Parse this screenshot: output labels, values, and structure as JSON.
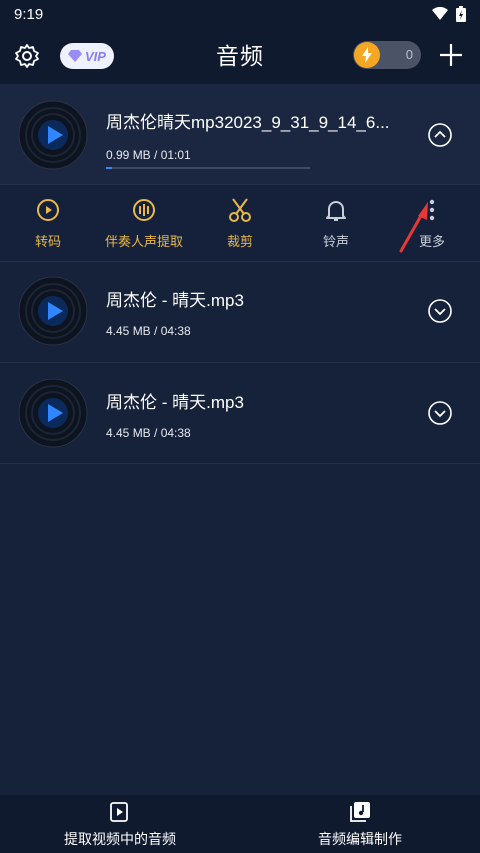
{
  "status": {
    "time": "9:19"
  },
  "header": {
    "title": "音频",
    "vip_label": "VIP",
    "coin_count": "0"
  },
  "files": [
    {
      "name": "周杰伦晴天mp32023_9_31_9_14_6...",
      "meta": "0.99 MB / 01:01",
      "progress": 0.03,
      "expanded": true
    },
    {
      "name": "周杰伦 - 晴天.mp3",
      "meta": "4.45 MB / 04:38",
      "expanded": false
    },
    {
      "name": "周杰伦 - 晴天.mp3",
      "meta": "4.45 MB / 04:38",
      "expanded": false
    }
  ],
  "actions": {
    "convert": "转码",
    "extract_vocals": "伴奏人声提取",
    "trim": "裁剪",
    "ringtone": "铃声",
    "more": "更多"
  },
  "bottom_nav": {
    "extract_audio": "提取视频中的音频",
    "audio_edit": "音频编辑制作"
  },
  "colors": {
    "accent_gold": "#e8b84a",
    "accent_blue": "#2f86ff",
    "arrow_red": "#e53935"
  }
}
